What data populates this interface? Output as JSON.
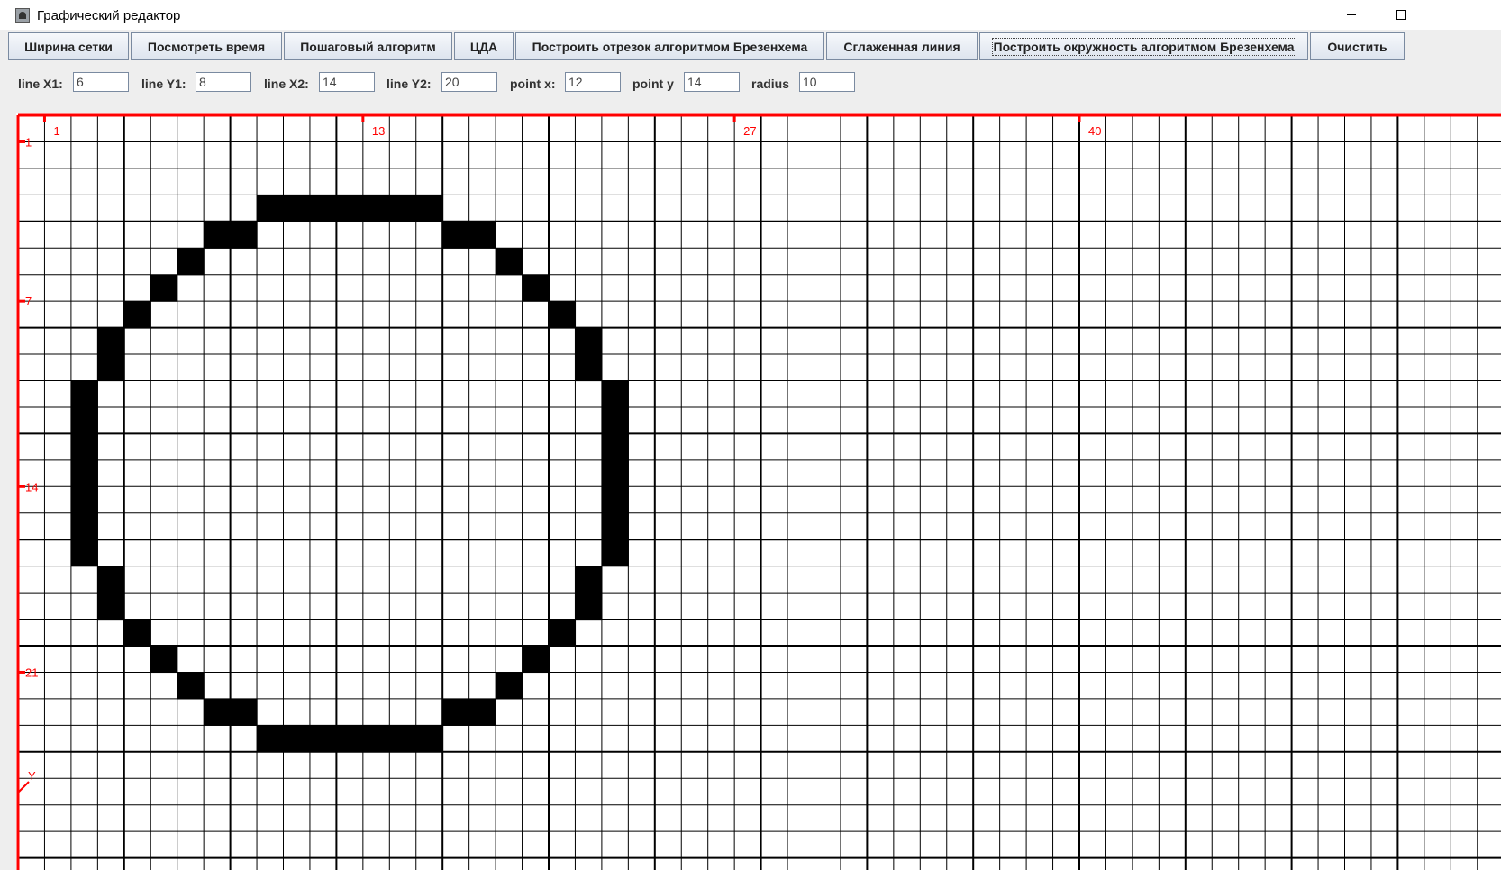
{
  "window": {
    "title": "Графический редактор",
    "icon": "app-image-icon",
    "controls": [
      "minimize-icon",
      "maximize-icon"
    ]
  },
  "toolbar": {
    "buttons": [
      {
        "id": "grid-width",
        "label": "Ширина сетки"
      },
      {
        "id": "view-time",
        "label": "Посмотреть время"
      },
      {
        "id": "step-algorithm",
        "label": "Пошаговый алгоритм"
      },
      {
        "id": "dda",
        "label": "ЦДА"
      },
      {
        "id": "bresenham-line",
        "label": "Построить отрезок алгоритмом Брезенхема"
      },
      {
        "id": "smooth-line",
        "label": "Сглаженная линия"
      },
      {
        "id": "bresenham-circle",
        "label": "Построить окружность алгоритмом Брезенхема",
        "focused": true
      },
      {
        "id": "clear",
        "label": "Очистить"
      }
    ]
  },
  "params": [
    {
      "label": "line X1:",
      "value": "6"
    },
    {
      "label": "line Y1:",
      "value": "8"
    },
    {
      "label": "line X2:",
      "value": "14"
    },
    {
      "label": "line Y2:",
      "value": "20"
    },
    {
      "label": "point x:",
      "value": "12"
    },
    {
      "label": "point y",
      "value": "14"
    },
    {
      "label": "radius",
      "value": "10"
    }
  ],
  "canvas": {
    "axis_color": "#ff0000",
    "grid_color": "#000000",
    "fill_color": "#000000",
    "x_tick_labels": [
      {
        "col": 1,
        "text": "1"
      },
      {
        "col": 13,
        "text": "13"
      },
      {
        "col": 27,
        "text": "27"
      },
      {
        "col": 40,
        "text": "40"
      }
    ],
    "y_tick_labels": [
      {
        "row": 1,
        "text": "1"
      },
      {
        "row": 7,
        "text": "7"
      },
      {
        "row": 14,
        "text": "14"
      },
      {
        "row": 21,
        "text": "21"
      }
    ],
    "y_axis_label": "Y",
    "filled_cells": [
      [
        10,
        4
      ],
      [
        11,
        4
      ],
      [
        12,
        4
      ],
      [
        13,
        4
      ],
      [
        14,
        4
      ],
      [
        15,
        4
      ],
      [
        16,
        4
      ],
      [
        8,
        5
      ],
      [
        9,
        5
      ],
      [
        17,
        5
      ],
      [
        18,
        5
      ],
      [
        7,
        6
      ],
      [
        19,
        6
      ],
      [
        6,
        7
      ],
      [
        20,
        7
      ],
      [
        5,
        8
      ],
      [
        21,
        8
      ],
      [
        4,
        9
      ],
      [
        22,
        9
      ],
      [
        4,
        10
      ],
      [
        22,
        10
      ],
      [
        3,
        11
      ],
      [
        23,
        11
      ],
      [
        3,
        12
      ],
      [
        23,
        12
      ],
      [
        3,
        13
      ],
      [
        23,
        13
      ],
      [
        3,
        14
      ],
      [
        23,
        14
      ],
      [
        3,
        15
      ],
      [
        23,
        15
      ],
      [
        3,
        16
      ],
      [
        23,
        16
      ],
      [
        3,
        17
      ],
      [
        23,
        17
      ],
      [
        4,
        18
      ],
      [
        22,
        18
      ],
      [
        4,
        19
      ],
      [
        22,
        19
      ],
      [
        5,
        20
      ],
      [
        21,
        20
      ],
      [
        6,
        21
      ],
      [
        20,
        21
      ],
      [
        7,
        22
      ],
      [
        19,
        22
      ],
      [
        8,
        23
      ],
      [
        9,
        23
      ],
      [
        17,
        23
      ],
      [
        18,
        23
      ],
      [
        10,
        24
      ],
      [
        11,
        24
      ],
      [
        12,
        24
      ],
      [
        13,
        24
      ],
      [
        14,
        24
      ],
      [
        15,
        24
      ],
      [
        16,
        24
      ]
    ]
  }
}
